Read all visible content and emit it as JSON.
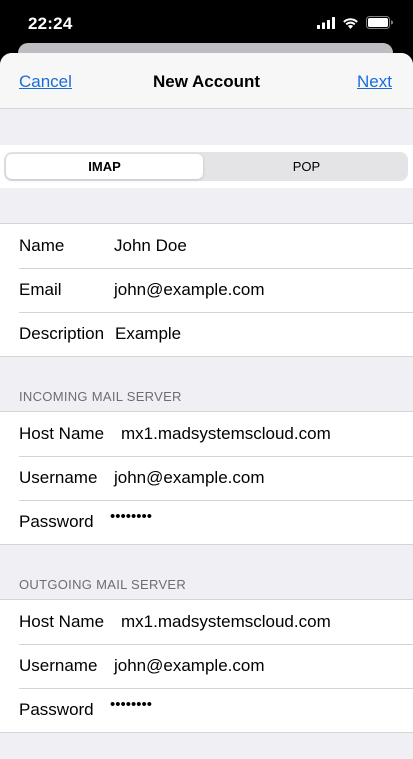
{
  "status_bar": {
    "time": "22:24"
  },
  "nav": {
    "cancel": "Cancel",
    "title": "New Account",
    "next": "Next"
  },
  "segmented": {
    "selected": "IMAP",
    "options": [
      "IMAP",
      "POP"
    ]
  },
  "account": {
    "name_label": "Name",
    "name_value": "John Doe",
    "email_label": "Email",
    "email_value": "john@example.com",
    "description_label": "Description",
    "description_value": "Example"
  },
  "incoming": {
    "header": "INCOMING MAIL SERVER",
    "host_label": "Host Name",
    "host_value": "mx1.madsystemscloud.com",
    "user_label": "Username",
    "user_value": "john@example.com",
    "password_label": "Password",
    "password_value": "••••••••"
  },
  "outgoing": {
    "header": "OUTGOING MAIL SERVER",
    "host_label": "Host Name",
    "host_value": "mx1.madsystemscloud.com",
    "user_label": "Username",
    "user_value": "john@example.com",
    "password_label": "Password",
    "password_value": "••••••••"
  },
  "colors": {
    "accent": "#1a6bd8",
    "background": "#efeff4",
    "section_text": "#6d6d72"
  }
}
